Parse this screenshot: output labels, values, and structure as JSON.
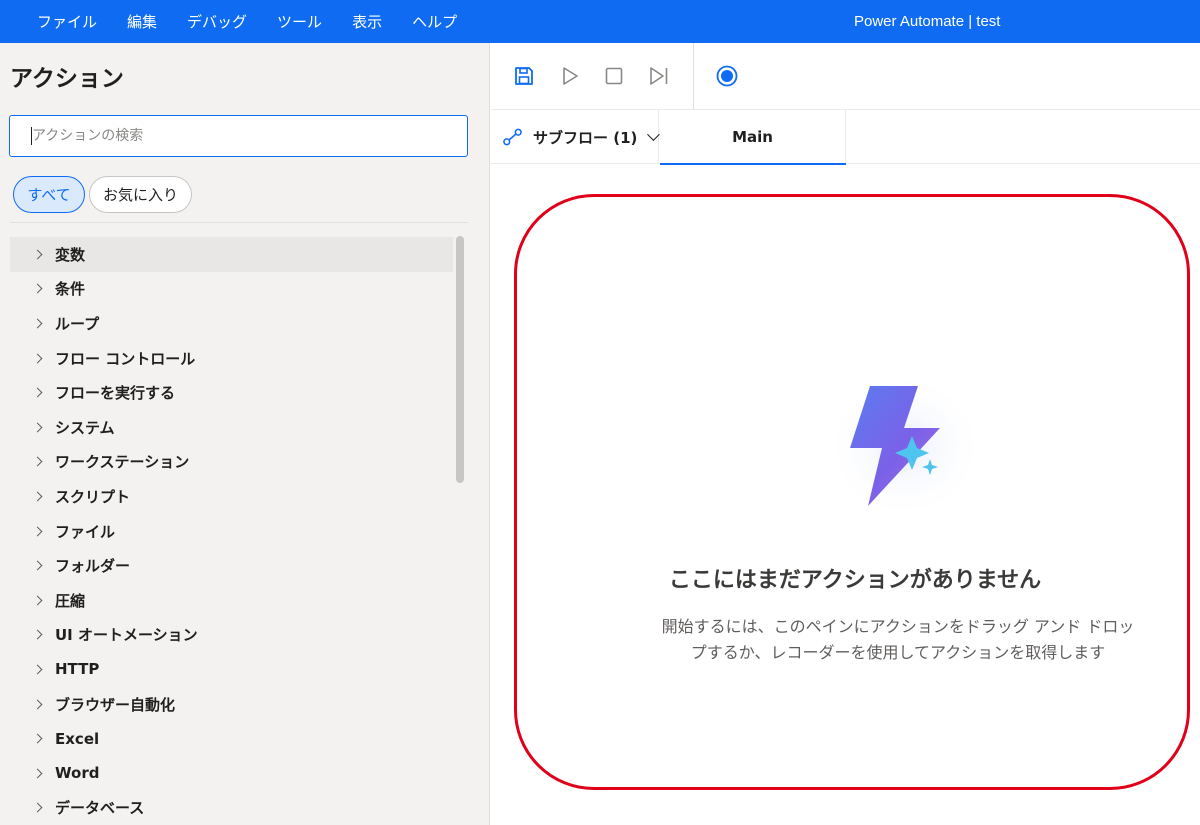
{
  "menu": [
    "ファイル",
    "編集",
    "デバッグ",
    "ツール",
    "表示",
    "ヘルプ"
  ],
  "app_title": "Power Automate | test",
  "actions_pane": {
    "title": "アクション",
    "search_placeholder": "アクションの検索",
    "filters": {
      "all": "すべて",
      "favorites": "お気に入り"
    },
    "categories": [
      "変数",
      "条件",
      "ループ",
      "フロー コントロール",
      "フローを実行する",
      "システム",
      "ワークステーション",
      "スクリプト",
      "ファイル",
      "フォルダー",
      "圧縮",
      "UI オートメーション",
      "HTTP",
      "ブラウザー自動化",
      "Excel",
      "Word",
      "データベース"
    ]
  },
  "toolbar": {
    "icons": [
      "save-icon",
      "run-icon",
      "stop-icon",
      "run-next-action-icon",
      "recorder-icon"
    ]
  },
  "tabs": {
    "subflow_label": "サブフロー (1)",
    "main_label": "Main"
  },
  "empty_state": {
    "title": "ここにはまだアクションがありません",
    "description": "開始するには、このペインにアクションをドラッグ アンド ドロップするか、レコーダーを使用してアクションを取得します"
  },
  "colors": {
    "accent": "#0f6cf2",
    "highlight": "#e0001a"
  }
}
